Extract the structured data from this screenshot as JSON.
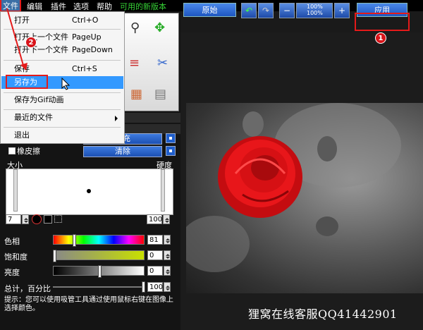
{
  "menubar": {
    "items": [
      "文件",
      "编辑",
      "插件",
      "选项",
      "帮助"
    ],
    "new_version": "可用的新版本"
  },
  "file_menu": {
    "items": [
      {
        "label": "打开",
        "shortcut": "Ctrl+O"
      },
      {
        "label": "打开上一个文件",
        "shortcut": "PageUp"
      },
      {
        "label": "打开下一个文件",
        "shortcut": "PageDown"
      },
      {
        "label": "保存",
        "shortcut": "Ctrl+S"
      },
      {
        "label": "另存为",
        "shortcut": ""
      },
      {
        "label": "保存为Gif动画",
        "shortcut": ""
      },
      {
        "label": "最近的文件",
        "shortcut": ""
      },
      {
        "label": "退出",
        "shortcut": ""
      }
    ],
    "highlighted": "另存为"
  },
  "steps": {
    "one": "1",
    "two": "2"
  },
  "toolbar": {
    "original_label": "原始",
    "zoom_label_top": "100%",
    "zoom_label_bottom": "100%",
    "apply_label": "应用"
  },
  "brush_panel": {
    "fill_label": "填充",
    "eraser_label": "橡皮擦",
    "clear_label": "清除",
    "size_label": "大小",
    "hardness_label": "硬度",
    "size_value": "7",
    "hardness_value": "100"
  },
  "color_panel": {
    "hue_label": "色相",
    "hue_value": "81",
    "saturation_label": "饱和度",
    "saturation_value": "0",
    "brightness_label": "亮度",
    "brightness_value": "0",
    "total_label": "总计，百分比",
    "total_value": "100"
  },
  "hint": "提示：您可以使用吸管工具通过使用鼠标右键在图像上选择颜色。",
  "watermark": "狸窝在线客服QQ41442901",
  "colors": {
    "accent_blue": "#1d56c0",
    "highlight": "#3399ff",
    "callout_red": "#e41a1a",
    "new_version_green": "#35d235"
  }
}
